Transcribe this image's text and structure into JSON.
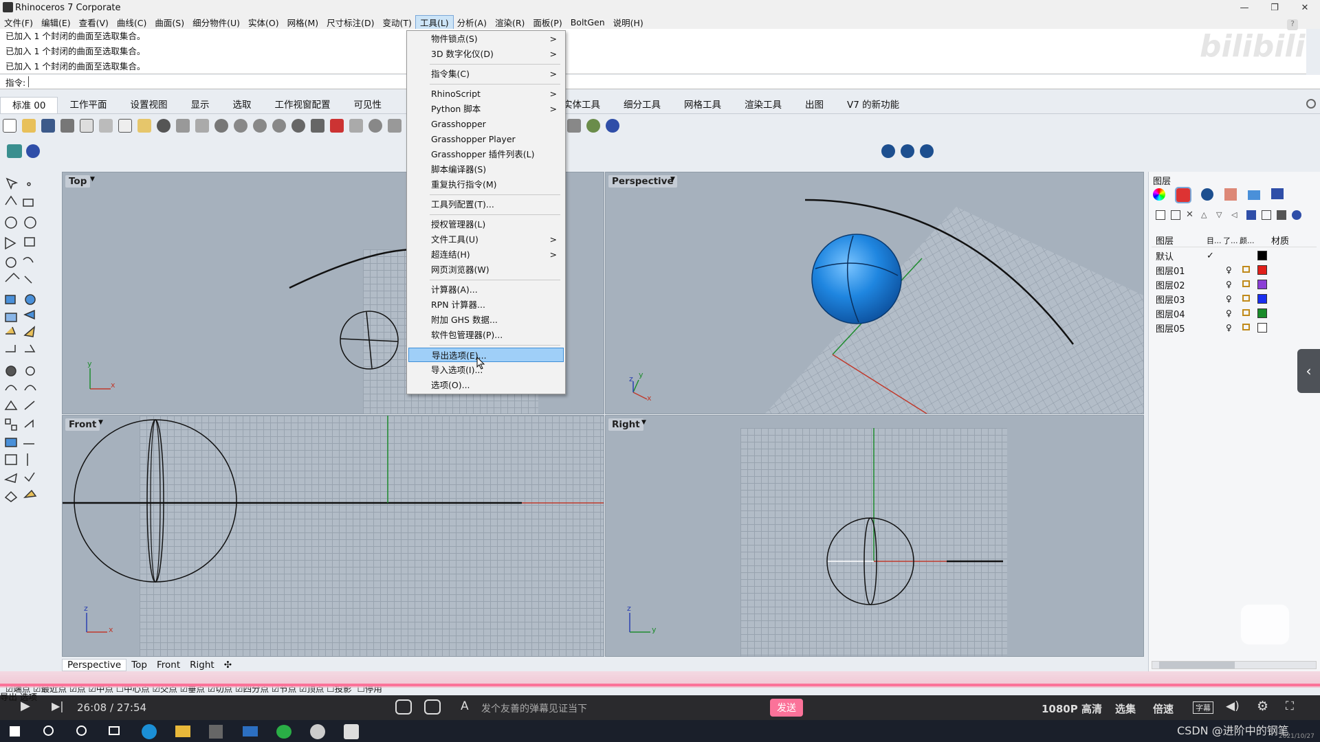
{
  "window": {
    "title": "Rhinoceros 7 Corporate",
    "controls": [
      "—",
      "❐",
      "✕"
    ]
  },
  "menubar": [
    "文件(F)",
    "编辑(E)",
    "查看(V)",
    "曲线(C)",
    "曲面(S)",
    "细分物件(U)",
    "实体(O)",
    "网格(M)",
    "尺寸标注(D)",
    "变动(T)",
    "工具(L)",
    "分析(A)",
    "渲染(R)",
    "面板(P)",
    "BoltGen",
    "说明(H)"
  ],
  "command_history": [
    "已加入 1 个封闭的曲面至选取集合。",
    "已加入 1 个封闭的曲面至选取集合。",
    "已加入 1 个封闭的曲面至选取集合。"
  ],
  "command_prompt": "指令:",
  "tabs": [
    "标准 00",
    "工作平面",
    "设置视图",
    "显示",
    "选取",
    "工作视窗配置",
    "可见性",
    "实体工具",
    "细分工具",
    "网格工具",
    "渲染工具",
    "出图",
    "V7 的新功能"
  ],
  "tools_menu": {
    "items": [
      {
        "label": "物件锁点(S)",
        "sub": ">"
      },
      {
        "label": "3D 数字化仪(D)",
        "sub": ">"
      },
      {
        "label": "指令集(C)",
        "sub": ">"
      },
      {
        "label": "RhinoScript",
        "sub": ">"
      },
      {
        "label": "Python 脚本",
        "sub": ">"
      },
      {
        "label": "Grasshopper",
        "sub": ""
      },
      {
        "label": "Grasshopper Player",
        "sub": ""
      },
      {
        "label": "Grasshopper 插件列表(L)",
        "sub": ""
      },
      {
        "label": "脚本编译器(S)",
        "sub": ""
      },
      {
        "label": "重复执行指令(M)",
        "sub": ""
      },
      {
        "label": "工具列配置(T)...",
        "sub": ""
      },
      {
        "label": "授权管理器(L)",
        "sub": ""
      },
      {
        "label": "文件工具(U)",
        "sub": ">"
      },
      {
        "label": "超连结(H)",
        "sub": ">"
      },
      {
        "label": "网页浏览器(W)",
        "sub": ""
      },
      {
        "label": "计算器(A)...",
        "sub": ""
      },
      {
        "label": "RPN 计算器...",
        "sub": ""
      },
      {
        "label": "附加 GHS 数据...",
        "sub": ""
      },
      {
        "label": "软件包管理器(P)...",
        "sub": ""
      },
      {
        "label": "导出选项(E)...",
        "sub": ""
      },
      {
        "label": "导入选项(I)...",
        "sub": ""
      },
      {
        "label": "选项(O)...",
        "sub": ""
      }
    ],
    "highlighted": "导出选项(E)..."
  },
  "viewports": {
    "top": "Top",
    "perspective": "Perspective",
    "front": "Front",
    "right": "Right",
    "axes": {
      "x": "x",
      "y": "y",
      "z": "z"
    }
  },
  "viewport_tabs": [
    "Perspective",
    "Top",
    "Front",
    "Right",
    "✣"
  ],
  "layers_panel": {
    "title": "图层",
    "columns": [
      "图层",
      "目...",
      "了...",
      "颜...",
      "材质"
    ],
    "rows": [
      {
        "name": "默认",
        "current": "✓",
        "color": "#000000"
      },
      {
        "name": "图层01",
        "color": "#e0201b"
      },
      {
        "name": "图层02",
        "color": "#8b3fd6"
      },
      {
        "name": "图层03",
        "color": "#1a2ff0"
      },
      {
        "name": "图层04",
        "color": "#1a8c2a"
      },
      {
        "name": "图层05",
        "color": "#ffffff"
      }
    ]
  },
  "osnap_bar": [
    "端点",
    "最近点",
    "点",
    "中点",
    "中心点",
    "交点",
    "垂点",
    "切点",
    "四分点",
    "节点",
    "顶点",
    "投影",
    "停用"
  ],
  "status_left": "导出 选项",
  "player": {
    "time": "26:08 / 27:54",
    "danmaku_placeholder": "发个友善的弹幕见证当下",
    "send": "发送",
    "quality": "1080P 高清",
    "episodes": "选集",
    "speed": "倍速",
    "subtitle": "字幕",
    "watermark": "CSDN @进阶中的钢笔",
    "date": "2021/10/27"
  },
  "colors": {
    "accent": "#fb7299",
    "highlight": "#9fcff8",
    "viewport_bg": "#a6b1bd",
    "sphere": "#1f86e0"
  }
}
